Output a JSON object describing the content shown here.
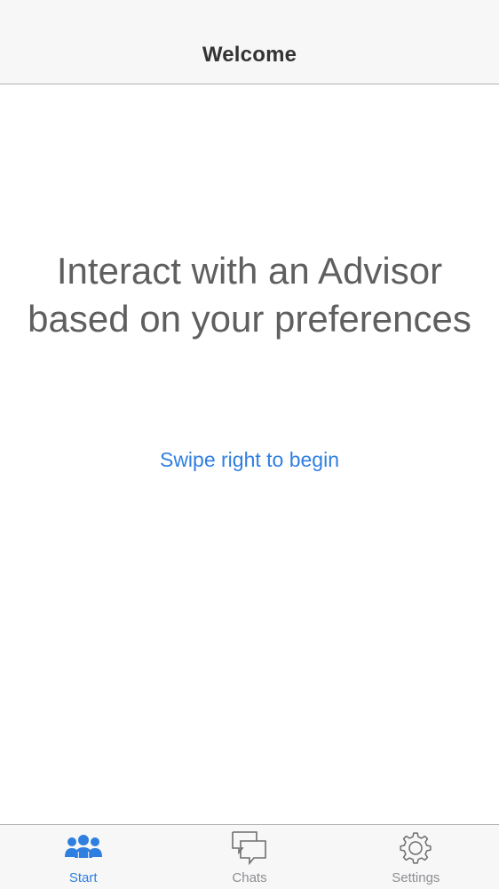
{
  "nav": {
    "title": "Welcome"
  },
  "main": {
    "headline": "Interact with an Advisor based on your preferences",
    "cta": "Swipe right to begin"
  },
  "tabs": [
    {
      "label": "Start",
      "icon": "people-icon",
      "active": true
    },
    {
      "label": "Chats",
      "icon": "chat-bubbles-icon",
      "active": false
    },
    {
      "label": "Settings",
      "icon": "gear-icon",
      "active": false
    }
  ],
  "colors": {
    "accent": "#2f7fe0",
    "inactive": "#8e8e93",
    "headline": "#5f5f5f",
    "bar_background": "#f7f7f7"
  }
}
